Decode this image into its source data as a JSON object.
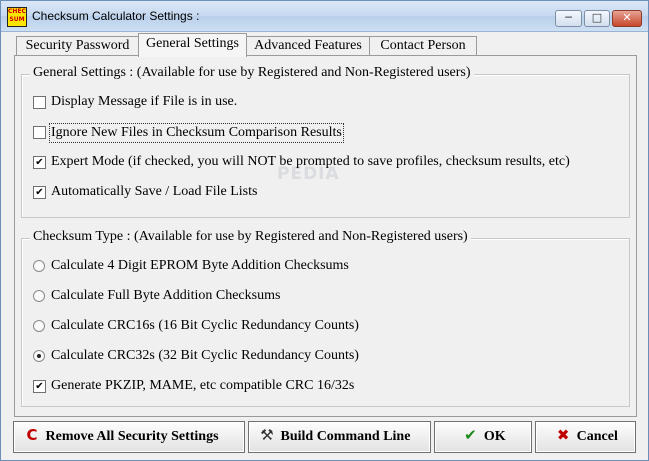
{
  "window": {
    "title": "Checksum Calculator Settings :",
    "app_icon_text": "CHECK SUM",
    "controls": {
      "minimize": "─",
      "maximize": "□",
      "close": "✕"
    }
  },
  "tabs": [
    {
      "label": "Security Password",
      "active": false
    },
    {
      "label": "General Settings",
      "active": true
    },
    {
      "label": "Advanced Features",
      "active": false
    },
    {
      "label": "Contact Person",
      "active": false
    }
  ],
  "general": {
    "legend": "General Settings :   (Available for use by Registered and Non-Registered users)",
    "items": [
      {
        "label": "Display Message if File is in use.",
        "checked": false,
        "check_glyph": ""
      },
      {
        "label": "Ignore New Files in Checksum Comparison Results",
        "checked": false,
        "check_glyph": ""
      },
      {
        "label": "Expert Mode (if checked, you will NOT be prompted to  save profiles, checksum results, etc)",
        "checked": true,
        "check_glyph": "✔"
      },
      {
        "label": "Automatically Save / Load File Lists",
        "checked": true,
        "check_glyph": "✔"
      }
    ]
  },
  "checksum": {
    "legend": "Checksum Type :   (Available for use by Registered and Non-Registered users)",
    "options": [
      {
        "label": "Calculate 4 Digit EPROM Byte Addition Checksums",
        "selected": false
      },
      {
        "label": "Calculate Full Byte Addition Checksums",
        "selected": false
      },
      {
        "label": "Calculate CRC16s (16 Bit Cyclic Redundancy Counts)",
        "selected": false
      },
      {
        "label": "Calculate CRC32s (32 Bit Cyclic Redundancy Counts)",
        "selected": true
      }
    ],
    "extra": {
      "label": "Generate PKZIP, MAME, etc compatible CRC 16/32s",
      "checked": true,
      "check_glyph": "✔"
    }
  },
  "watermark": "PEDIA",
  "buttons": {
    "remove_security": {
      "label": "Remove All Security Settings",
      "icon": "C",
      "color": "#c00000"
    },
    "build_cmd": {
      "label": "Build Command Line",
      "icon": "⚒",
      "color": "#333333"
    },
    "ok": {
      "label": "OK",
      "icon": "✔",
      "color": "#1a8a1a"
    },
    "cancel": {
      "label": "Cancel",
      "icon": "✖",
      "color": "#c00000"
    }
  }
}
